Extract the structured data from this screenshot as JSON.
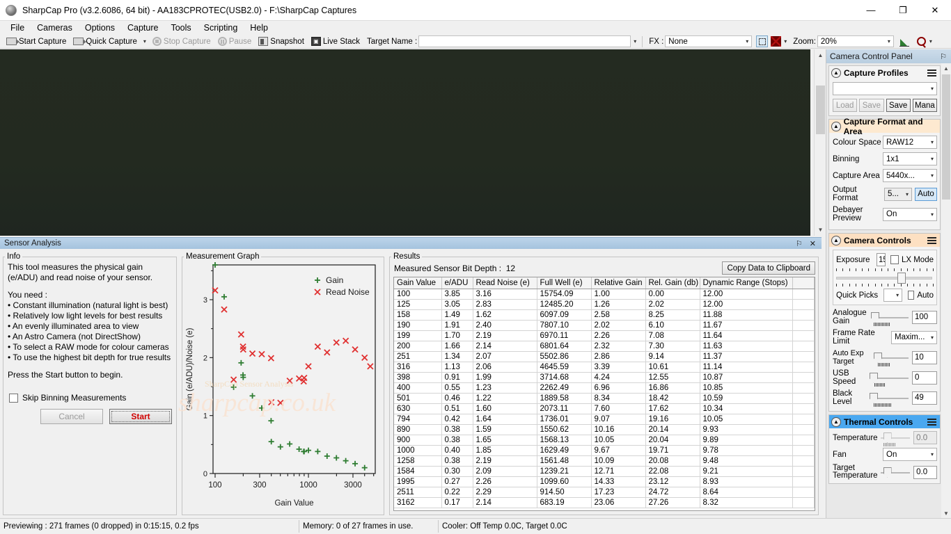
{
  "window": {
    "title": "SharpCap Pro (v3.2.6086, 64 bit) - AA183CPROTEC(USB2.0) - F:\\SharpCap Captures",
    "minimize": "—",
    "maximize": "❐",
    "close": "✕"
  },
  "menu": [
    "File",
    "Cameras",
    "Options",
    "Capture",
    "Tools",
    "Scripting",
    "Help"
  ],
  "toolbar": {
    "start_capture": "Start Capture",
    "quick_capture": "Quick Capture",
    "stop_capture": "Stop Capture",
    "pause": "Pause",
    "snapshot": "Snapshot",
    "live_stack": "Live Stack",
    "target_name_label": "Target Name :",
    "target_name_value": "",
    "fx_label": "FX :",
    "fx_value": "None",
    "zoom_label": "Zoom:",
    "zoom_value": "20%",
    "dropdown_caret": "▾"
  },
  "sensor_analysis": {
    "title": "Sensor Analysis",
    "pin": "⚐",
    "close": "✕",
    "info": {
      "legend": "Info",
      "paragraph1": "This tool measures the physical gain (e/ADU) and read noise of your sensor.",
      "needs_heading": "You need :",
      "needs": [
        "• Constant illumination (natural light is best)",
        "• Relatively low light levels for best results",
        "• An evenly illuminated area to view",
        "• An Astro Camera (not DirectShow)",
        "• To select a RAW mode for colour cameras",
        "• To use the highest bit depth for true results"
      ],
      "paragraph2": "Press the Start button to begin.",
      "skip_binning_label": "Skip Binning Measurements",
      "cancel_button": "Cancel",
      "start_button": "Start"
    },
    "graph": {
      "legend": "Measurement Graph",
      "watermark_top": "SharpCap Sensor Analysis",
      "watermark_main": "sharpcap.co.uk"
    },
    "results": {
      "legend": "Results",
      "bit_depth_label": "Measured Sensor Bit Depth :",
      "bit_depth_value": "12",
      "copy_button": "Copy Data to Clipboard",
      "columns": [
        "Gain Value",
        "e/ADU",
        "Read Noise (e)",
        "Full Well (e)",
        "Relative Gain",
        "Rel. Gain (db)",
        "Dynamic Range (Stops)",
        ""
      ],
      "rows": [
        [
          "100",
          "3.85",
          "3.16",
          "15754.09",
          "1.00",
          "0.00",
          "12.00",
          ""
        ],
        [
          "125",
          "3.05",
          "2.83",
          "12485.20",
          "1.26",
          "2.02",
          "12.00",
          ""
        ],
        [
          "158",
          "1.49",
          "1.62",
          "6097.09",
          "2.58",
          "8.25",
          "11.88",
          ""
        ],
        [
          "190",
          "1.91",
          "2.40",
          "7807.10",
          "2.02",
          "6.10",
          "11.67",
          ""
        ],
        [
          "199",
          "1.70",
          "2.19",
          "6970.11",
          "2.26",
          "7.08",
          "11.64",
          ""
        ],
        [
          "200",
          "1.66",
          "2.14",
          "6801.64",
          "2.32",
          "7.30",
          "11.63",
          ""
        ],
        [
          "251",
          "1.34",
          "2.07",
          "5502.86",
          "2.86",
          "9.14",
          "11.37",
          ""
        ],
        [
          "316",
          "1.13",
          "2.06",
          "4645.59",
          "3.39",
          "10.61",
          "11.14",
          ""
        ],
        [
          "398",
          "0.91",
          "1.99",
          "3714.68",
          "4.24",
          "12.55",
          "10.87",
          ""
        ],
        [
          "400",
          "0.55",
          "1.23",
          "2262.49",
          "6.96",
          "16.86",
          "10.85",
          ""
        ],
        [
          "501",
          "0.46",
          "1.22",
          "1889.58",
          "8.34",
          "18.42",
          "10.59",
          ""
        ],
        [
          "630",
          "0.51",
          "1.60",
          "2073.11",
          "7.60",
          "17.62",
          "10.34",
          ""
        ],
        [
          "794",
          "0.42",
          "1.64",
          "1736.01",
          "9.07",
          "19.16",
          "10.05",
          ""
        ],
        [
          "890",
          "0.38",
          "1.59",
          "1550.62",
          "10.16",
          "20.14",
          "9.93",
          ""
        ],
        [
          "900",
          "0.38",
          "1.65",
          "1568.13",
          "10.05",
          "20.04",
          "9.89",
          ""
        ],
        [
          "1000",
          "0.40",
          "1.85",
          "1629.49",
          "9.67",
          "19.71",
          "9.78",
          ""
        ],
        [
          "1258",
          "0.38",
          "2.19",
          "1561.48",
          "10.09",
          "20.08",
          "9.48",
          ""
        ],
        [
          "1584",
          "0.30",
          "2.09",
          "1239.21",
          "12.71",
          "22.08",
          "9.21",
          ""
        ],
        [
          "1995",
          "0.27",
          "2.26",
          "1099.60",
          "14.33",
          "23.12",
          "8.93",
          ""
        ],
        [
          "2511",
          "0.22",
          "2.29",
          "914.50",
          "17.23",
          "24.72",
          "8.64",
          ""
        ],
        [
          "3162",
          "0.17",
          "2.14",
          "683.19",
          "23.06",
          "27.26",
          "8.32",
          ""
        ]
      ]
    }
  },
  "chart_data": {
    "type": "scatter",
    "title": "Measurement Graph",
    "xlabel": "Gain Value",
    "ylabel": "Gain (e/ADU)/Noise (e)",
    "x_scale": "log",
    "xticks": [
      "100",
      "300",
      "1000",
      "3000"
    ],
    "yticks": [
      "0",
      "1",
      "2",
      "3"
    ],
    "ylim": [
      0,
      3.6
    ],
    "xlim": [
      95,
      5200
    ],
    "legend": [
      {
        "name": "Gain",
        "marker": "plus",
        "color": "#2f7d32"
      },
      {
        "name": "Read Noise",
        "marker": "cross",
        "color": "#e03030"
      }
    ],
    "series": [
      {
        "name": "Gain",
        "marker": "plus",
        "color": "#2f7d32",
        "x": [
          100,
          125,
          158,
          190,
          199,
          200,
          251,
          316,
          398,
          400,
          501,
          630,
          794,
          890,
          900,
          1000,
          1258,
          1584,
          1995,
          2511,
          3162,
          4000
        ],
        "y": [
          3.85,
          3.05,
          1.49,
          1.91,
          1.7,
          1.66,
          1.34,
          1.13,
          0.91,
          0.55,
          0.46,
          0.51,
          0.42,
          0.38,
          0.38,
          0.4,
          0.38,
          0.3,
          0.27,
          0.22,
          0.17,
          0.1
        ]
      },
      {
        "name": "Read Noise",
        "marker": "cross",
        "color": "#e03030",
        "x": [
          100,
          125,
          158,
          190,
          199,
          200,
          251,
          316,
          398,
          400,
          501,
          630,
          794,
          890,
          900,
          1000,
          1258,
          1584,
          1995,
          2511,
          3162,
          4000,
          4600
        ],
        "y": [
          3.16,
          2.83,
          1.62,
          2.4,
          2.19,
          2.14,
          2.07,
          2.06,
          1.99,
          1.23,
          1.22,
          1.6,
          1.64,
          1.59,
          1.65,
          1.85,
          2.19,
          2.09,
          2.26,
          2.29,
          2.14,
          2.0,
          1.85
        ]
      }
    ]
  },
  "camera_panel": {
    "title": "Camera Control Panel",
    "pin_icon": "⚐",
    "sections": {
      "capture_profiles": {
        "title": "Capture Profiles",
        "profile_value": "",
        "load": "Load",
        "save_disabled": "Save",
        "save": "Save",
        "manage": "Mana"
      },
      "capture_format": {
        "title": "Capture Format and Area",
        "fields": [
          {
            "label": "Colour Space",
            "value": "RAW12"
          },
          {
            "label": "Binning",
            "value": "1x1"
          },
          {
            "label": "Capture Area",
            "value": "5440x..."
          },
          {
            "label": "Output Format",
            "value": "5..."
          },
          {
            "label": "Debayer Preview",
            "value": "On"
          }
        ],
        "auto_button": "Auto"
      },
      "camera_controls": {
        "title": "Camera Controls",
        "exposure_label": "Exposure",
        "exposure_value": "15",
        "lx_mode_label": "LX Mode",
        "quick_picks_label": "Quick Picks",
        "quick_picks_value": "",
        "auto_label": "Auto",
        "fields": [
          {
            "label": "Analogue Gain",
            "value": "100"
          },
          {
            "label": "Auto Exp Target",
            "value": "10"
          },
          {
            "label": "USB Speed",
            "value": "0"
          },
          {
            "label": "Black Level",
            "value": "49"
          }
        ],
        "frame_rate_label": "Frame Rate Limit",
        "frame_rate_value": "Maxim..."
      },
      "thermal_controls": {
        "title": "Thermal Controls",
        "temperature_label": "Temperature",
        "temperature_value": "0.0",
        "fan_label": "Fan",
        "fan_value": "On",
        "target_temp_label": "Target Temperature",
        "target_temp_value": "0.0"
      }
    }
  },
  "statusbar": {
    "preview": "Previewing : 271 frames (0 dropped) in 0:15:15, 0.2 fps",
    "memory": "Memory: 0 of 27 frames in use.",
    "cooler": "Cooler: Off Temp 0.0C, Target 0.0C"
  }
}
